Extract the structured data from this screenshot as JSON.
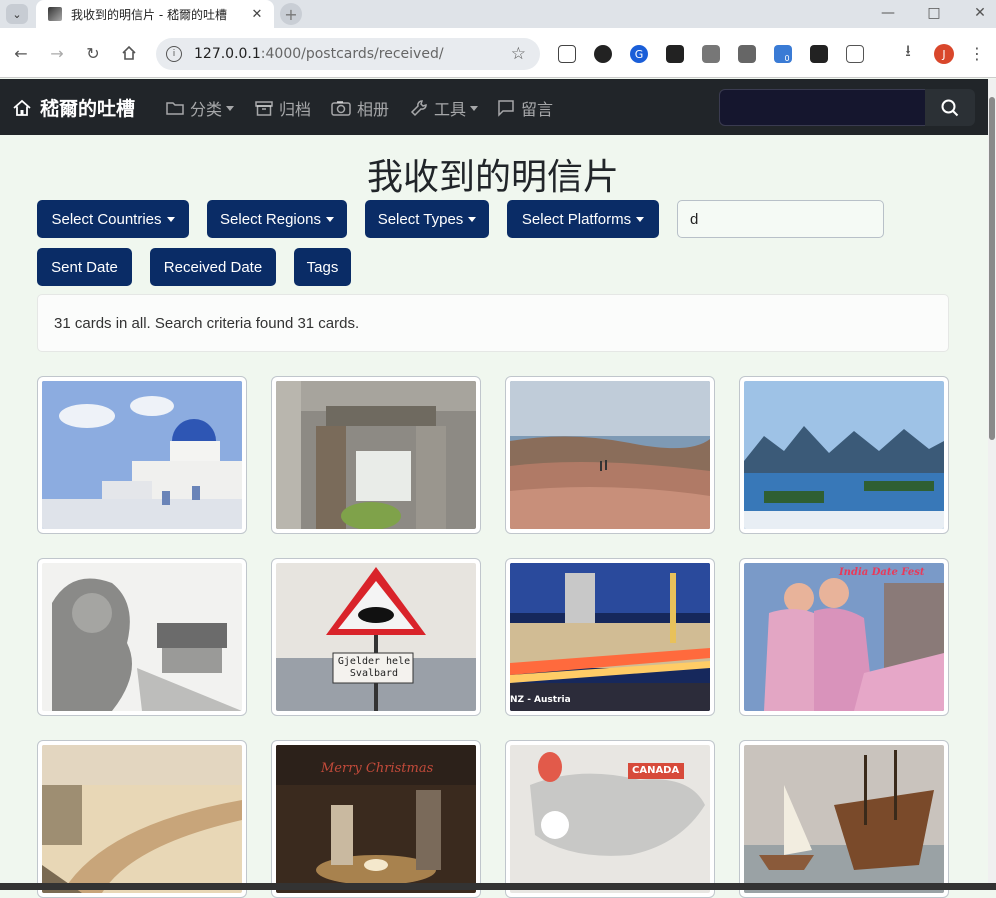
{
  "browser": {
    "tab_title": "我收到的明信片 - 嵇爾的吐槽",
    "url_host": "127.0.0.1",
    "url_rest": ":4000/postcards/received/",
    "profile_initial": "J",
    "ext_badge": "0"
  },
  "navbar": {
    "brand": "嵇爾的吐槽",
    "items": [
      {
        "label": "分类",
        "icon": "folder-icon",
        "dropdown": true
      },
      {
        "label": "归档",
        "icon": "archive-icon",
        "dropdown": false
      },
      {
        "label": "相册",
        "icon": "camera-icon",
        "dropdown": false
      },
      {
        "label": "工具",
        "icon": "wrench-icon",
        "dropdown": true
      },
      {
        "label": "留言",
        "icon": "chat-icon",
        "dropdown": false
      }
    ]
  },
  "page": {
    "title": "我收到的明信片",
    "filters": {
      "countries": "Select Countries",
      "regions": "Select Regions",
      "types": "Select Types",
      "platforms": "Select Platforms",
      "search_value": "d"
    },
    "sort_buttons": {
      "sent_date": "Sent Date",
      "received_date": "Received Date",
      "tags": "Tags"
    },
    "result_text": "31 cards in all. Search criteria found 31 cards."
  },
  "cards": [
    {
      "caption": "",
      "theme": "santorini"
    },
    {
      "caption": "",
      "theme": "gate"
    },
    {
      "caption": "",
      "theme": "hills"
    },
    {
      "caption": "",
      "theme": "lake"
    },
    {
      "caption": "",
      "theme": "lion"
    },
    {
      "caption": "Gjelder hele Svalbard",
      "theme": "polarbear"
    },
    {
      "caption": "NZ - Austria",
      "theme": "city-night"
    },
    {
      "caption": "India Date Fest",
      "theme": "dancers"
    },
    {
      "caption": "",
      "theme": "river"
    },
    {
      "caption": "Merry Christmas",
      "theme": "nativity"
    },
    {
      "caption": "CANADA",
      "theme": "map"
    },
    {
      "caption": "",
      "theme": "ships"
    }
  ],
  "colors": {
    "navbar_bg": "#212529",
    "button_bg": "#0a2c66",
    "page_bg": "#f0f7ef"
  }
}
